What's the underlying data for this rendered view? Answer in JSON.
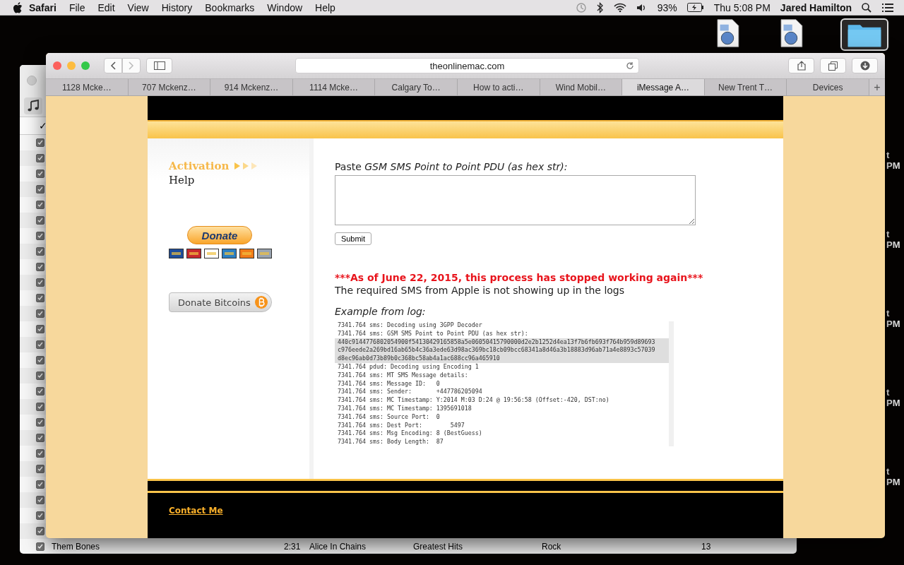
{
  "menu_bar": {
    "app": "Safari",
    "menus": [
      "File",
      "Edit",
      "View",
      "History",
      "Bookmarks",
      "Window",
      "Help"
    ],
    "battery": "93%",
    "clock": "Thu 5:08 PM",
    "user": "Jared Hamilton"
  },
  "desktop": {
    "icon_labels": [
      {
        "line_1": "t",
        "line_2": "PM"
      },
      {
        "line_1": "t",
        "line_2": "PM"
      },
      {
        "line_1": "t",
        "line_2": "PM"
      },
      {
        "line_1": "t",
        "line_2": "PM"
      },
      {
        "line_1": "t",
        "line_2": "PM"
      }
    ]
  },
  "itunes": {
    "check_header": "✓",
    "rows": [
      {
        "checked": true
      },
      {
        "checked": true
      },
      {
        "checked": true
      },
      {
        "checked": true
      },
      {
        "checked": true
      },
      {
        "checked": true
      },
      {
        "checked": true
      },
      {
        "checked": true
      },
      {
        "checked": true
      },
      {
        "checked": true
      },
      {
        "checked": true
      },
      {
        "checked": true
      },
      {
        "checked": true
      },
      {
        "checked": true
      },
      {
        "checked": true
      },
      {
        "checked": true
      },
      {
        "checked": true
      },
      {
        "checked": true
      },
      {
        "checked": true
      },
      {
        "checked": true
      },
      {
        "checked": true
      },
      {
        "checked": true
      },
      {
        "checked": true
      },
      {
        "checked": true
      },
      {
        "checked": true
      },
      {
        "checked": true
      }
    ],
    "last_row": {
      "checked": true,
      "name": "Them Bones",
      "time": "2:31",
      "artist": "Alice In Chains",
      "album": "Greatest Hits",
      "genre": "Rock",
      "plays": "13"
    }
  },
  "safari": {
    "address": "theonlinemac.com",
    "tabs": [
      {
        "label": "1128 Mcke…",
        "selected": false
      },
      {
        "label": "707 Mckenz…",
        "selected": false
      },
      {
        "label": "914 Mckenz…",
        "selected": false
      },
      {
        "label": "1114 Mcke…",
        "selected": false
      },
      {
        "label": "Calgary To…",
        "selected": false
      },
      {
        "label": "How to acti…",
        "selected": false
      },
      {
        "label": "Wind Mobil…",
        "selected": false
      },
      {
        "label": "iMessage A…",
        "selected": true
      },
      {
        "label": "New Trent T…",
        "selected": false
      }
    ],
    "devices_tab": "Devices",
    "new_tab": "+"
  },
  "page": {
    "nav": [
      {
        "label": "Activation",
        "selected": true
      },
      {
        "label": "Help",
        "selected": false
      }
    ],
    "donate_button": "Donate",
    "bitcoin_button": "Donate Bitcoins",
    "paste_label": "Paste *GSM SMS Point to Point PDU (as hex str):*",
    "submit": "Submit",
    "warning": "***As of June 22, 2015, this process has stopped working again***",
    "note": "The required SMS from Apple is not showing up in the logs",
    "example_label": "Example from log:",
    "log": [
      {
        "text": "7341.764 sms: Decoding using 3GPP Decoder",
        "highlighted": false
      },
      {
        "text": "7341.764 sms: GSM SMS Point to Point PDU (as hex str):",
        "highlighted": false
      },
      {
        "text": "440c9144776802054900f54130429165858a5e06050415790000d2e2b1252d4ea13f7b6fb693f764b959d89693",
        "highlighted": true
      },
      {
        "text": "c976eede2a269bd16ab65b4c36a3ede63d98ac369bc18cb09bcc68341a8d46a3b18883d96ab71a4e8893c57039",
        "highlighted": true
      },
      {
        "text": "d8ec96ab0d73b89b0c368bc58ab4a1ac688cc96a465910",
        "highlighted": true
      },
      {
        "text": "7341.764 pdud: Decoding using Encoding 1",
        "highlighted": false
      },
      {
        "text": "7341.764 sms: MT SMS Message details:",
        "highlighted": false
      },
      {
        "text": "7341.764 sms: Message ID:   0",
        "highlighted": false
      },
      {
        "text": "7341.764 sms: Sender:       +447786205094",
        "highlighted": false
      },
      {
        "text": "7341.764 sms: MC Timestamp: Y:2014 M:03 D:24 @ 19:56:58 (Offset:-420, DST:no)",
        "highlighted": false
      },
      {
        "text": "7341.764 sms: MC Timestamp: 1395691018",
        "highlighted": false
      },
      {
        "text": "7341.764 sms: Source Port:  0",
        "highlighted": false
      },
      {
        "text": "7341.764 sms: Dest Port:        5497",
        "highlighted": false
      },
      {
        "text": "7341.764 sms: Msg Encoding: 8 (BestGuess)",
        "highlighted": false
      },
      {
        "text": "7341.764 sms: Body Length:  87",
        "highlighted": false
      }
    ],
    "footer_link": "Contact Me"
  }
}
